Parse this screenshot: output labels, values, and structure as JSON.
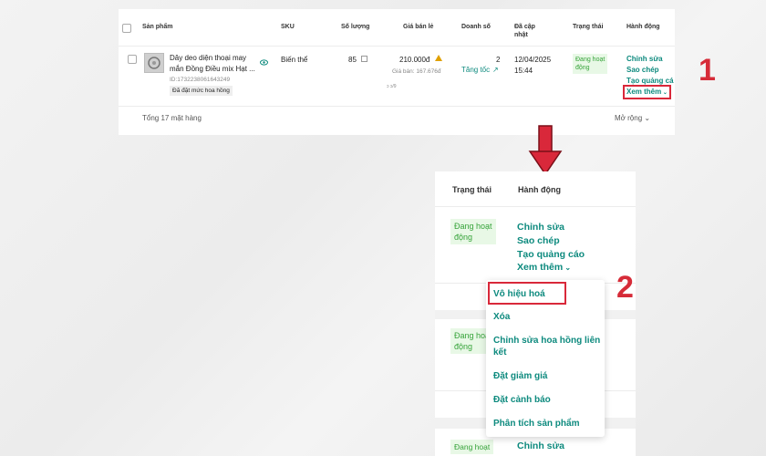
{
  "table": {
    "headers": {
      "product": "Sản phẩm",
      "sku": "SKU",
      "quantity": "Số lượng",
      "price": "Giá bán lẻ",
      "revenue": "Doanh số",
      "updated": "Đã cập nhật",
      "status": "Trạng thái",
      "actions": "Hành động"
    },
    "row": {
      "name_line1": "Dây deo diện thoại may",
      "name_line2": "mắn Đồng Điều mix Hạt ...",
      "product_id": "ID:1732238061643249",
      "affiliate_tag": "Đã đặt mức hoa hồng",
      "sku": "Biến thể",
      "quantity": "85",
      "price": "210.000đ",
      "sale_price": "Giá bán: 167.676đ",
      "price_note": "ↄ ↄ/9",
      "revenue_count": "2",
      "boost": "Tăng tốc",
      "updated_date": "12/04/2025",
      "updated_time": "15:44",
      "status_line1": "Đang hoạt",
      "status_line2": "động",
      "actions": {
        "edit": "Chỉnh sửa",
        "copy": "Sao chép",
        "create_ad": "Tạo quảng cá",
        "see_more": "Xem thêm"
      }
    },
    "footer_total": "Tổng 17 mặt hàng",
    "expand": "Mở rộng"
  },
  "zoom": {
    "status_header": "Trạng thái",
    "actions_header": "Hành động",
    "row1_status_line1": "Đang hoạt",
    "row1_status_line2": "động",
    "row2_status_line1": "Đang hoạ",
    "row2_status_line2": "động",
    "row3_status": "Đang hoạt",
    "edit": "Chỉnh sửa",
    "copy": "Sao chép",
    "create_ad": "Tạo quảng cáo",
    "see_more": "Xem thêm",
    "row3_edit": "Chỉnh sửa"
  },
  "dropdown": {
    "items": [
      "Vô hiệu hoá",
      "Xóa",
      "Chỉnh sửa hoa hồng liên",
      "kết",
      "Đặt giảm giá",
      "Đặt cảnh báo",
      "Phân tích sản phẩm"
    ]
  },
  "step_labels": {
    "step1": "1",
    "step2": "2"
  },
  "colors": {
    "link": "#0d8a7e",
    "highlight": "#d9283a",
    "status_bg": "#e8f8e6",
    "status_text": "#36a33a"
  }
}
